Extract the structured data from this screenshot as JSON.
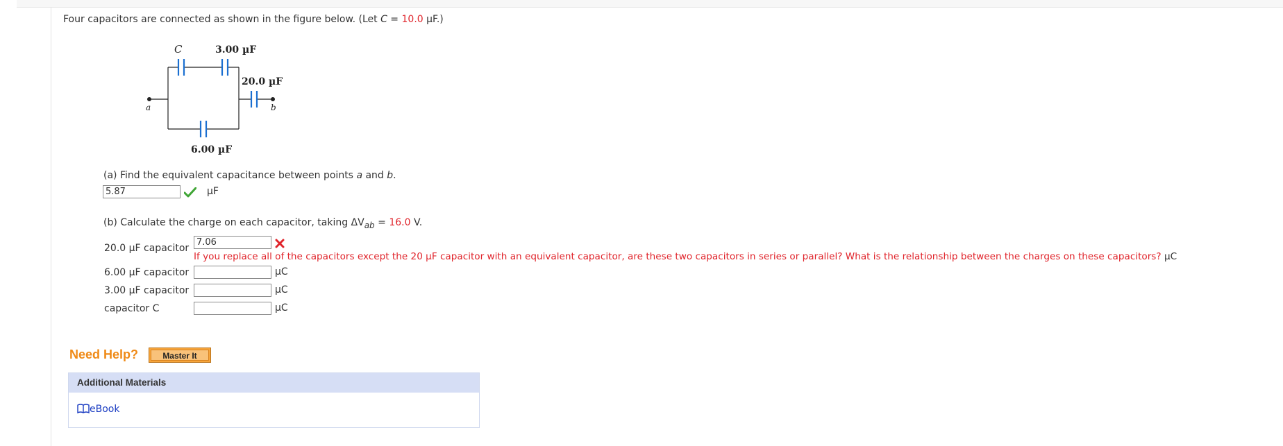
{
  "question": {
    "intro_prefix": "Four capacitors are connected as shown in the figure below. (Let ",
    "intro_var": "C",
    "intro_eq": " = ",
    "intro_value": "10.0",
    "intro_suffix": " µF.)"
  },
  "figure": {
    "label_C": "C",
    "label_3uF": "3.00 µF",
    "label_20uF": "20.0 µF",
    "label_6uF": "6.00 µF",
    "label_a": "a",
    "label_b": "b"
  },
  "part_a": {
    "prompt_prefix": "(a) Find the equivalent capacitance between points ",
    "var_a": "a",
    "prompt_mid": " and ",
    "var_b": "b",
    "prompt_suffix": ".",
    "answer": "5.87",
    "unit": "µF",
    "status": "correct"
  },
  "part_b": {
    "prompt_prefix": "(b) Calculate the charge on each capacitor, taking ΔV",
    "subscript": "ab",
    "prompt_eq": " = ",
    "value": "16.0",
    "prompt_suffix": " V.",
    "rows": [
      {
        "label": "20.0 µF capacitor",
        "answer": "7.06",
        "status": "incorrect"
      },
      {
        "label": "6.00 µF capacitor",
        "answer": "",
        "unit": "µC"
      },
      {
        "label": "3.00 µF capacitor",
        "answer": "",
        "unit": "µC"
      },
      {
        "label": "capacitor C",
        "answer": "",
        "unit": "µC"
      }
    ],
    "feedback": "If you replace all of the capacitors except the 20 µF capacitor with an equivalent capacitor, are these two capacitors in series or parallel? What is the relationship between the charges on these capacitors?",
    "feedback_unit": "µC"
  },
  "help": {
    "need_help": "Need Help?",
    "master_it": "Master It"
  },
  "materials": {
    "title": "Additional Materials",
    "ebook": "eBook"
  },
  "colors": {
    "red": "#e0242b",
    "orange": "#ef8a17",
    "green": "#3fa535",
    "blue_cap": "#1b6fd1",
    "link": "#1a3cc2"
  }
}
